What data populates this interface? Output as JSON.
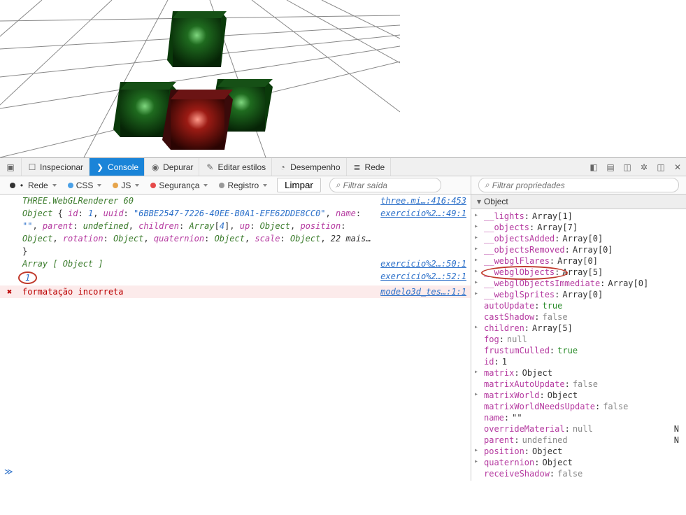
{
  "viewport_label": "3d-scene",
  "toolbar": {
    "inspect": "Inspecionar",
    "console": "Console",
    "debug": "Depurar",
    "edit_styles": "Editar estilos",
    "performance": "Desempenho",
    "network": "Rede"
  },
  "subbar": {
    "rede": "Rede",
    "css": "CSS",
    "js": "JS",
    "seguranca": "Segurança",
    "registro": "Registro",
    "limpar": "Limpar",
    "filter_ph": "Filtrar saída"
  },
  "sideSubbar": {
    "filter_ph": "Filtrar propriedades"
  },
  "sideHead": "Object",
  "console": {
    "l1": {
      "text": "THREE.WebGLRenderer 60",
      "src": "three.mi…:416:453"
    },
    "l2": {
      "segments": [
        "Object",
        " { ",
        "id",
        ": ",
        "1",
        ", ",
        "uuid",
        ": ",
        "\"6BBE2547-7226-40EE-B0A1-EFE62DDE8CC0\"",
        ", ",
        "name",
        ": "
      ],
      "src": "exercicio%2…:49:1"
    },
    "l3": {
      "segments": [
        "\"\"",
        ", ",
        "parent",
        ": ",
        "undefined",
        ", ",
        "children",
        ": ",
        "Array",
        "[",
        "4",
        "], ",
        "up",
        ": ",
        "Object",
        ", ",
        "position",
        ": "
      ]
    },
    "l4": {
      "segments": [
        "Object",
        ", ",
        "rotation",
        ": ",
        "Object",
        ", ",
        "quaternion",
        ": ",
        "Object",
        ", ",
        "scale",
        ": ",
        "Object",
        ", ",
        "22 mais…"
      ]
    },
    "l5": "}",
    "l6": {
      "text": "Array [ Object ]",
      "src": "exercicio%2…:50:1"
    },
    "l7": {
      "text": "1",
      "src": "exercicio%2…:52:1"
    },
    "l8": {
      "text": "formatação incorreta",
      "src": "modelo3d_tes…:1:1"
    }
  },
  "props": [
    {
      "name": "__lights",
      "val": "Array[1]",
      "tri": true
    },
    {
      "name": "__objects",
      "val": "Array[7]",
      "tri": true
    },
    {
      "name": "__objectsAdded",
      "val": "Array[0]",
      "tri": true
    },
    {
      "name": "__objectsRemoved",
      "val": "Array[0]",
      "tri": true
    },
    {
      "name": "__webglFlares",
      "val": "Array[0]",
      "tri": true
    },
    {
      "name": "__webglObjects",
      "val": "Array[5]",
      "tri": true,
      "circled": true
    },
    {
      "name": "__webglObjectsImmediate",
      "val": "Array[0]",
      "tri": true
    },
    {
      "name": "__webglSprites",
      "val": "Array[0]",
      "tri": true
    },
    {
      "name": "autoUpdate",
      "val": "true",
      "type": "bool-true"
    },
    {
      "name": "castShadow",
      "val": "false",
      "type": "bool-false"
    },
    {
      "name": "children",
      "val": "Array[5]",
      "tri": true
    },
    {
      "name": "fog",
      "val": "null",
      "type": "nullv"
    },
    {
      "name": "frustumCulled",
      "val": "true",
      "type": "bool-true"
    },
    {
      "name": "id",
      "val": "1"
    },
    {
      "name": "matrix",
      "val": "Object",
      "tri": true
    },
    {
      "name": "matrixAutoUpdate",
      "val": "false",
      "type": "bool-false"
    },
    {
      "name": "matrixWorld",
      "val": "Object",
      "tri": true
    },
    {
      "name": "matrixWorldNeedsUpdate",
      "val": "false",
      "type": "bool-false"
    },
    {
      "name": "name",
      "val": "\"\""
    },
    {
      "name": "overrideMaterial",
      "val": "null",
      "type": "nullv",
      "tag": "N"
    },
    {
      "name": "parent",
      "val": "undefined",
      "type": "nullv",
      "tag": "N"
    },
    {
      "name": "position",
      "val": "Object",
      "tri": true
    },
    {
      "name": "quaternion",
      "val": "Object",
      "tri": true
    },
    {
      "name": "receiveShadow",
      "val": "false",
      "type": "bool-false"
    }
  ],
  "prompt": "≫"
}
